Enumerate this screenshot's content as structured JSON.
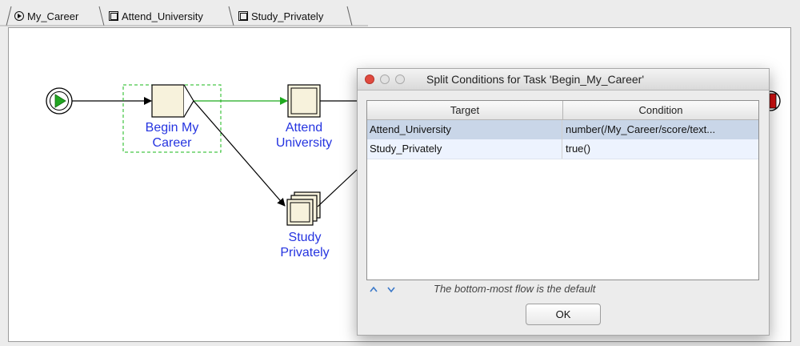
{
  "tabs": [
    {
      "label": "My_Career",
      "icon": "play-circle-icon"
    },
    {
      "label": "Attend_University",
      "icon": "composite-task-icon"
    },
    {
      "label": "Study_Privately",
      "icon": "composite-task-icon"
    }
  ],
  "net": {
    "tasks": [
      {
        "line1": "Begin My",
        "line2": "Career"
      },
      {
        "line1": "Attend",
        "line2": "University"
      },
      {
        "line1": "Study",
        "line2": "Privately"
      }
    ],
    "colors": {
      "label": "#2534e0",
      "task_fill": "#f7f2dc",
      "active_flow": "#1faa1f",
      "start": "#22a622"
    }
  },
  "dialog": {
    "title": "Split Conditions for Task 'Begin_My_Career'",
    "columns": [
      "Target",
      "Condition"
    ],
    "rows": [
      {
        "target": "Attend_University",
        "condition": "number(/My_Career/score/text..."
      },
      {
        "target": "Study_Privately",
        "condition": "true()"
      }
    ],
    "hint": "The bottom-most flow is the default",
    "ok_label": "OK",
    "move_up": "^",
    "move_down": "v"
  }
}
